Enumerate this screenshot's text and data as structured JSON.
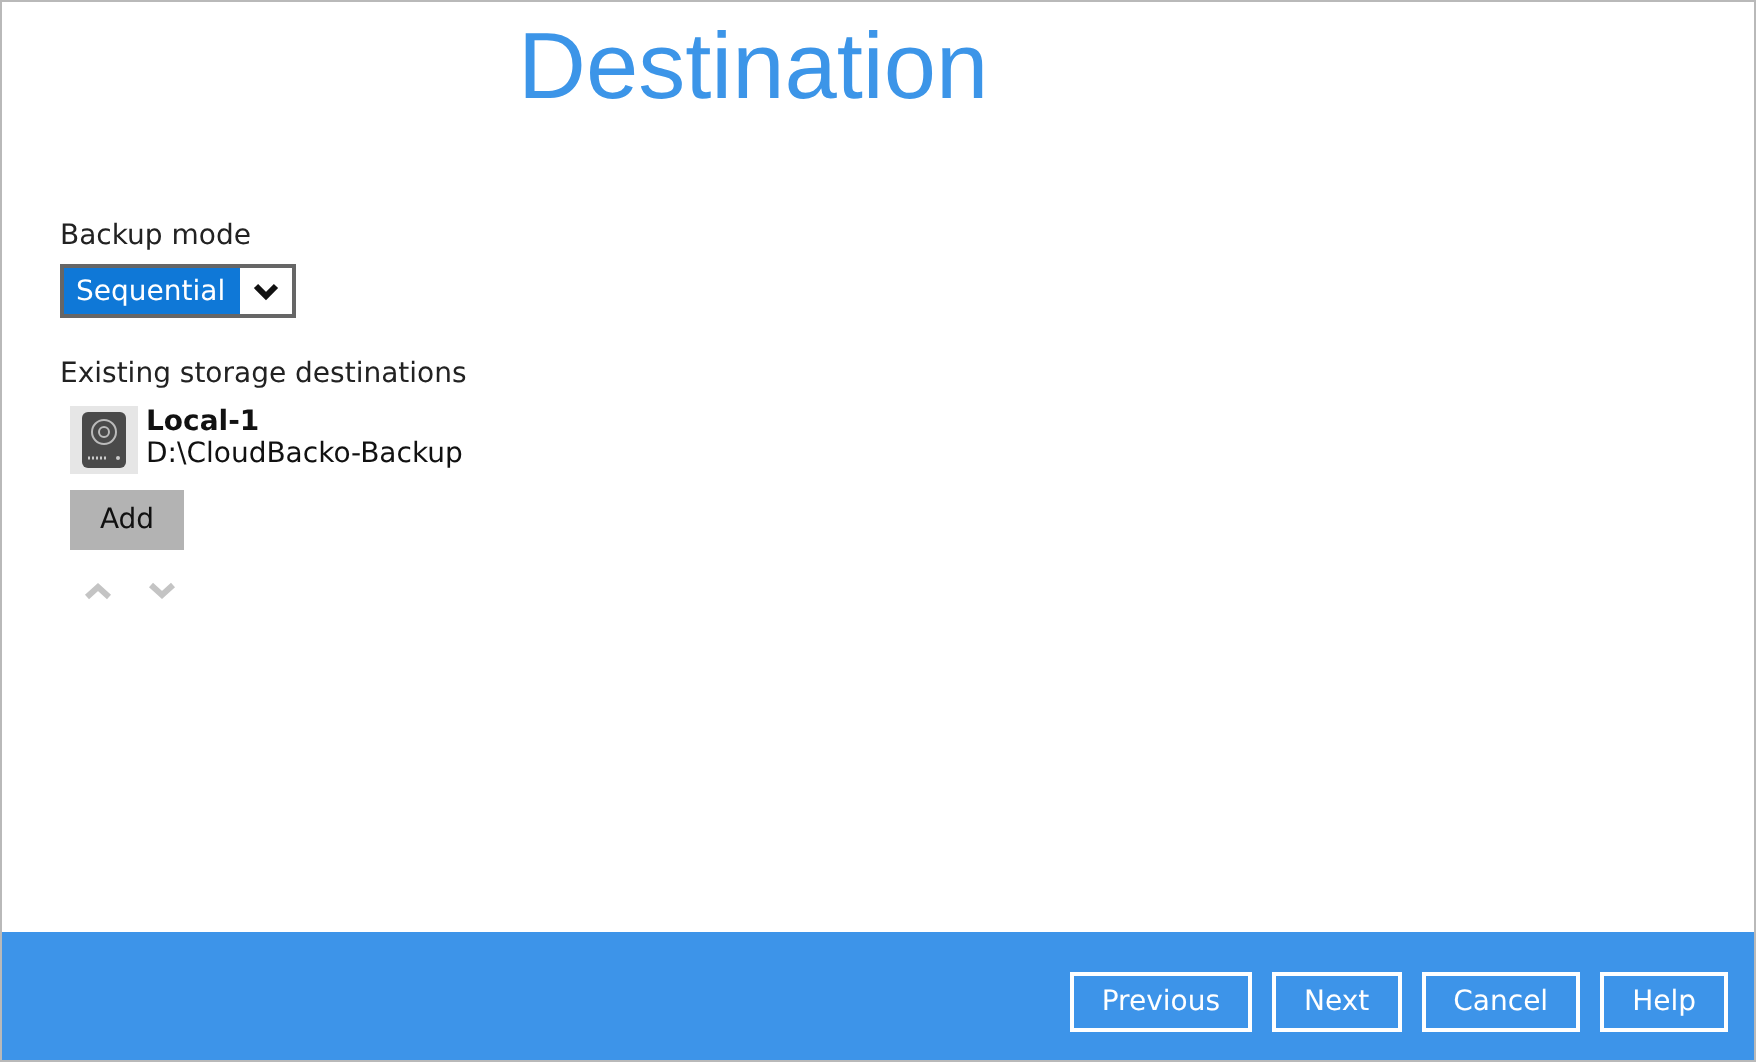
{
  "title": "Destination",
  "backup_mode": {
    "label": "Backup mode",
    "value": "Sequential"
  },
  "destinations": {
    "label": "Existing storage destinations",
    "items": [
      {
        "name": "Local-1",
        "path": "D:\\CloudBacko-Backup"
      }
    ],
    "add_button": "Add"
  },
  "footer_buttons": [
    "Previous",
    "Next",
    "Cancel",
    "Help"
  ]
}
